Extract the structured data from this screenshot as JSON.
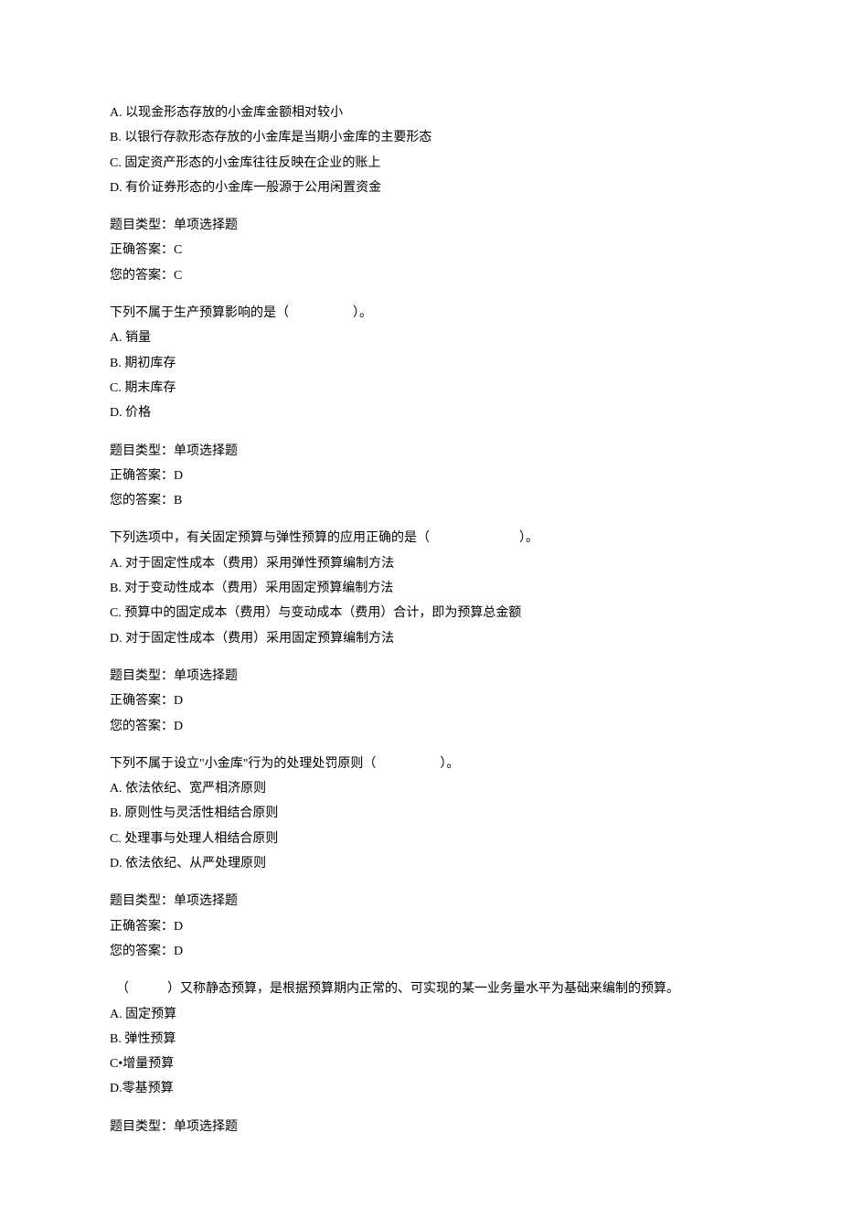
{
  "frag": {
    "options": [
      {
        "label": "A.  以现金形态存放的小金库金额相对较小"
      },
      {
        "label": "B.  以银行存款形态存放的小金库是当期小金库的主要形态"
      },
      {
        "label": "C.  固定资产形态的小金库往往反映在企业的账上"
      },
      {
        "label": "D.  有价证券形态的小金库一般源于公用闲置资金"
      }
    ],
    "meta_type": "题目类型：单项选择题",
    "meta_correct": "正确答案：C",
    "meta_your": "您的答案：C"
  },
  "q1": {
    "stem": "下列不属于生产预算影响的是（　　　　　）。",
    "options": [
      {
        "label": "A.  销量"
      },
      {
        "label": "B.  期初库存"
      },
      {
        "label": "C.  期末库存"
      },
      {
        "label": "D.  价格"
      }
    ],
    "meta_type": "题目类型：单项选择题",
    "meta_correct": "正确答案：D",
    "meta_your": "您的答案：B"
  },
  "q2": {
    "stem": "下列选项中，有关固定预算与弹性预算的应用正确的是（　　　　　　　）。",
    "options": [
      {
        "label": "A. 对于固定性成本（费用）采用弹性预算编制方法"
      },
      {
        "label": "B. 对于变动性成本（费用）采用固定预算编制方法"
      },
      {
        "label": "C. 预算中的固定成本（费用）与变动成本（费用）合计，即为预算总金额"
      },
      {
        "label": "D. 对于固定性成本（费用）采用固定预算编制方法"
      }
    ],
    "meta_type": "题目类型：单项选择题",
    "meta_correct": "正确答案：D",
    "meta_your": "您的答案：D"
  },
  "q3": {
    "stem": "下列不属于设立\"小金库\"行为的处理处罚原则（　　　　　）。",
    "options": [
      {
        "label": "A.  依法依纪、宽严相济原则"
      },
      {
        "label": "B.  原则性与灵活性相结合原则"
      },
      {
        "label": "C.  处理事与处理人相结合原则"
      },
      {
        "label": "D.  依法依纪、从严处理原则"
      }
    ],
    "meta_type": "题目类型：单项选择题",
    "meta_correct": "正确答案：D",
    "meta_your": "您的答案：D"
  },
  "q4": {
    "stem": "　（　　　）又称静态预算，是根据预算期内正常的、可实现的某一业务量水平为基础来编制的预算。",
    "options": [
      {
        "label": "A.  固定预算"
      },
      {
        "label": "B.  弹性预算"
      },
      {
        "label": "C•增量预算"
      },
      {
        "label": "D.零基预算"
      }
    ],
    "meta_type": "题目类型：单项选择题"
  }
}
